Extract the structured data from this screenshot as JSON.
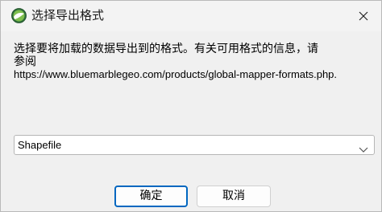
{
  "window": {
    "title": "选择导出格式",
    "icon": "globe-mapper-app-icon",
    "close_icon": "close-icon"
  },
  "message": {
    "line1": "选择要将加载的数据导出到的格式。有关可用格式的信息，请",
    "line2": "参阅",
    "url": "https://www.bluemarblegeo.com/products/global-mapper-formats.php."
  },
  "format_select": {
    "selected": "Shapefile",
    "arrow_icon": "chevron-down-icon"
  },
  "buttons": {
    "ok_label": "确定",
    "cancel_label": "取消"
  },
  "colors": {
    "default_button_border": "#0067c0",
    "background": "#f0f0f0"
  }
}
